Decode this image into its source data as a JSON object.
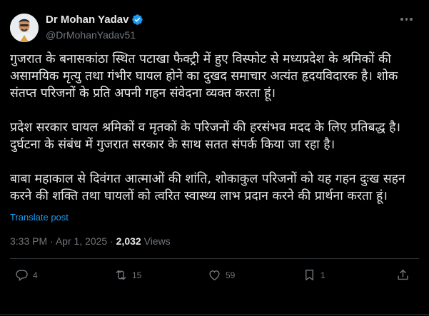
{
  "author": {
    "name": "Dr Mohan Yadav",
    "handle": "@DrMohanYadav51"
  },
  "post": {
    "paragraphs": [
      [
        "गुजरात के बनासकांठा स्थित पटाखा फैक्ट्री में हुए विस्फोट से मध्यप्रदेश के श्रमिकों की",
        "असामयिक मृत्यु तथा गंभीर घायल होने का दुखद समाचार अत्यंत हृदयविदारक है। शोक",
        "संतप्त परिजनों के प्रति अपनी गहन संवेदना व्यक्त करता हूं।"
      ],
      [
        "प्रदेश सरकार घायल श्रमिकों व मृतकों के परिजनों की हरसंभव मदद के लिए प्रतिबद्ध है।",
        "दुर्घटना के संबंध में गुजरात सरकार के साथ सतत संपर्क किया जा रहा है।"
      ],
      [
        "बाबा महाकाल से दिवंगत आत्माओं की शांति, शोकाकुल परिजनों को यह गहन दुःख सहन",
        "करने की शक्ति तथा घायलों को त्वरित स्वास्थ्य लाभ प्रदान करने की प्रार्थना करता हूं।"
      ]
    ],
    "translate_label": "Translate post",
    "time": "3:33 PM",
    "separator": "·",
    "date": "Apr 1, 2025",
    "views_count": "2,032",
    "views_label": "Views"
  },
  "actions": {
    "replies": "4",
    "reposts": "15",
    "likes": "59",
    "bookmarks": "1"
  },
  "icons": {
    "verified": "verified-badge-icon",
    "more": "more-dots-icon",
    "reply": "reply-icon",
    "repost": "repost-icon",
    "like": "heart-icon",
    "bookmark": "bookmark-icon",
    "share": "share-icon"
  },
  "colors": {
    "background": "#000000",
    "text": "#e7e9ea",
    "muted": "#71767b",
    "accent": "#1d9bf0"
  }
}
